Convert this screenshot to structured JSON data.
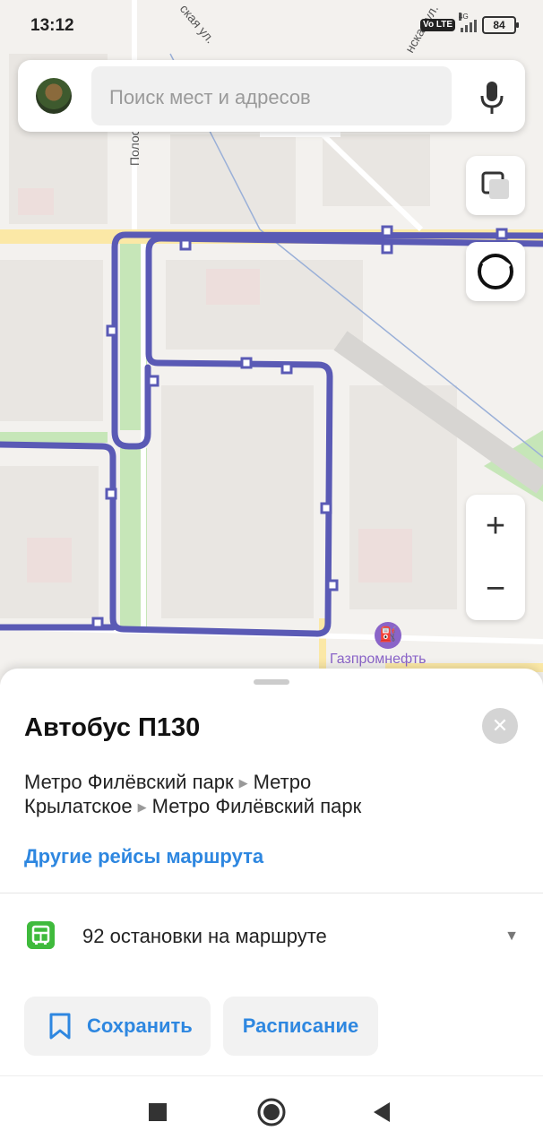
{
  "status": {
    "time": "13:12",
    "volte": "Vo LTE",
    "network": "4G",
    "battery": "84"
  },
  "search": {
    "placeholder": "Поиск мест и адресов"
  },
  "map": {
    "poi_label": "Газпромнефть",
    "street_labels": [
      "Полосухина ул.",
      "ская ул.",
      "нская ул."
    ],
    "route_color": "#5a5ab5",
    "zoom_in": "+",
    "zoom_out": "−"
  },
  "sheet": {
    "title": "Автобус П130",
    "route_line_1": [
      "Метро Филёвский парк",
      "Метро"
    ],
    "route_line_2": [
      "Крылатское",
      "Метро Филёвский парк"
    ],
    "other_trips": "Другие рейсы маршрута",
    "stops_text": "92 остановки на маршруте",
    "save_label": "Сохранить",
    "schedule_label": "Расписание",
    "accent": "#2e87e0"
  }
}
